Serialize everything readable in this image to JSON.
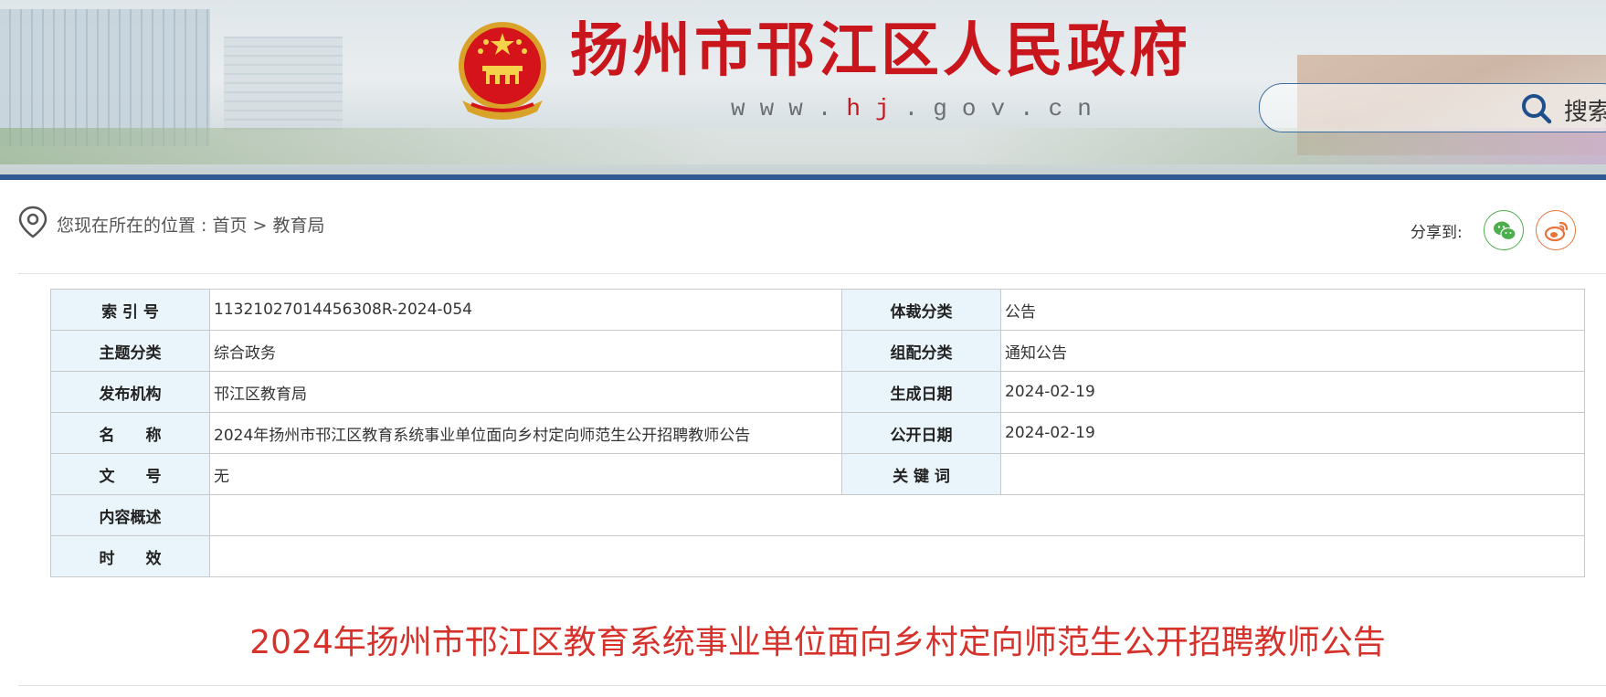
{
  "header": {
    "site_title": "扬州市邗江区人民政府",
    "url_prefix": "www.",
    "url_highlight": "hj",
    "url_suffix": ".gov.cn",
    "search_label": "搜索"
  },
  "breadcrumb": {
    "prefix": "您现在所在的位置 : ",
    "home": "首页",
    "separator": " > ",
    "current": "教育局"
  },
  "share": {
    "label": "分享到:"
  },
  "info_table": {
    "rows": [
      {
        "label1": "索 引 号",
        "value1": "11321027014456308R-2024-054",
        "label2": "体裁分类",
        "value2": "公告"
      },
      {
        "label1": "主题分类",
        "value1": "综合政务",
        "label2": "组配分类",
        "value2": "通知公告"
      },
      {
        "label1": "发布机构",
        "value1": "邗江区教育局",
        "label2": "生成日期",
        "value2": "2024-02-19"
      },
      {
        "label1": "名　　称",
        "value1": "2024年扬州市邗江区教育系统事业单位面向乡村定向师范生公开招聘教师公告",
        "label2": "公开日期",
        "value2": "2024-02-19"
      },
      {
        "label1": "文　　号",
        "value1": "无",
        "label2": "关 键 词",
        "value2": ""
      }
    ],
    "summary_label": "内容概述",
    "summary_value": "",
    "validity_label": "时　　效",
    "validity_value": ""
  },
  "article_title": "2024年扬州市邗江区教育系统事业单位面向乡村定向师范生公开招聘教师公告",
  "colors": {
    "brand_red": "#c9161d",
    "title_red": "#d6322b",
    "header_line": "#2f5b94",
    "label_bg": "#eaf4fb"
  }
}
